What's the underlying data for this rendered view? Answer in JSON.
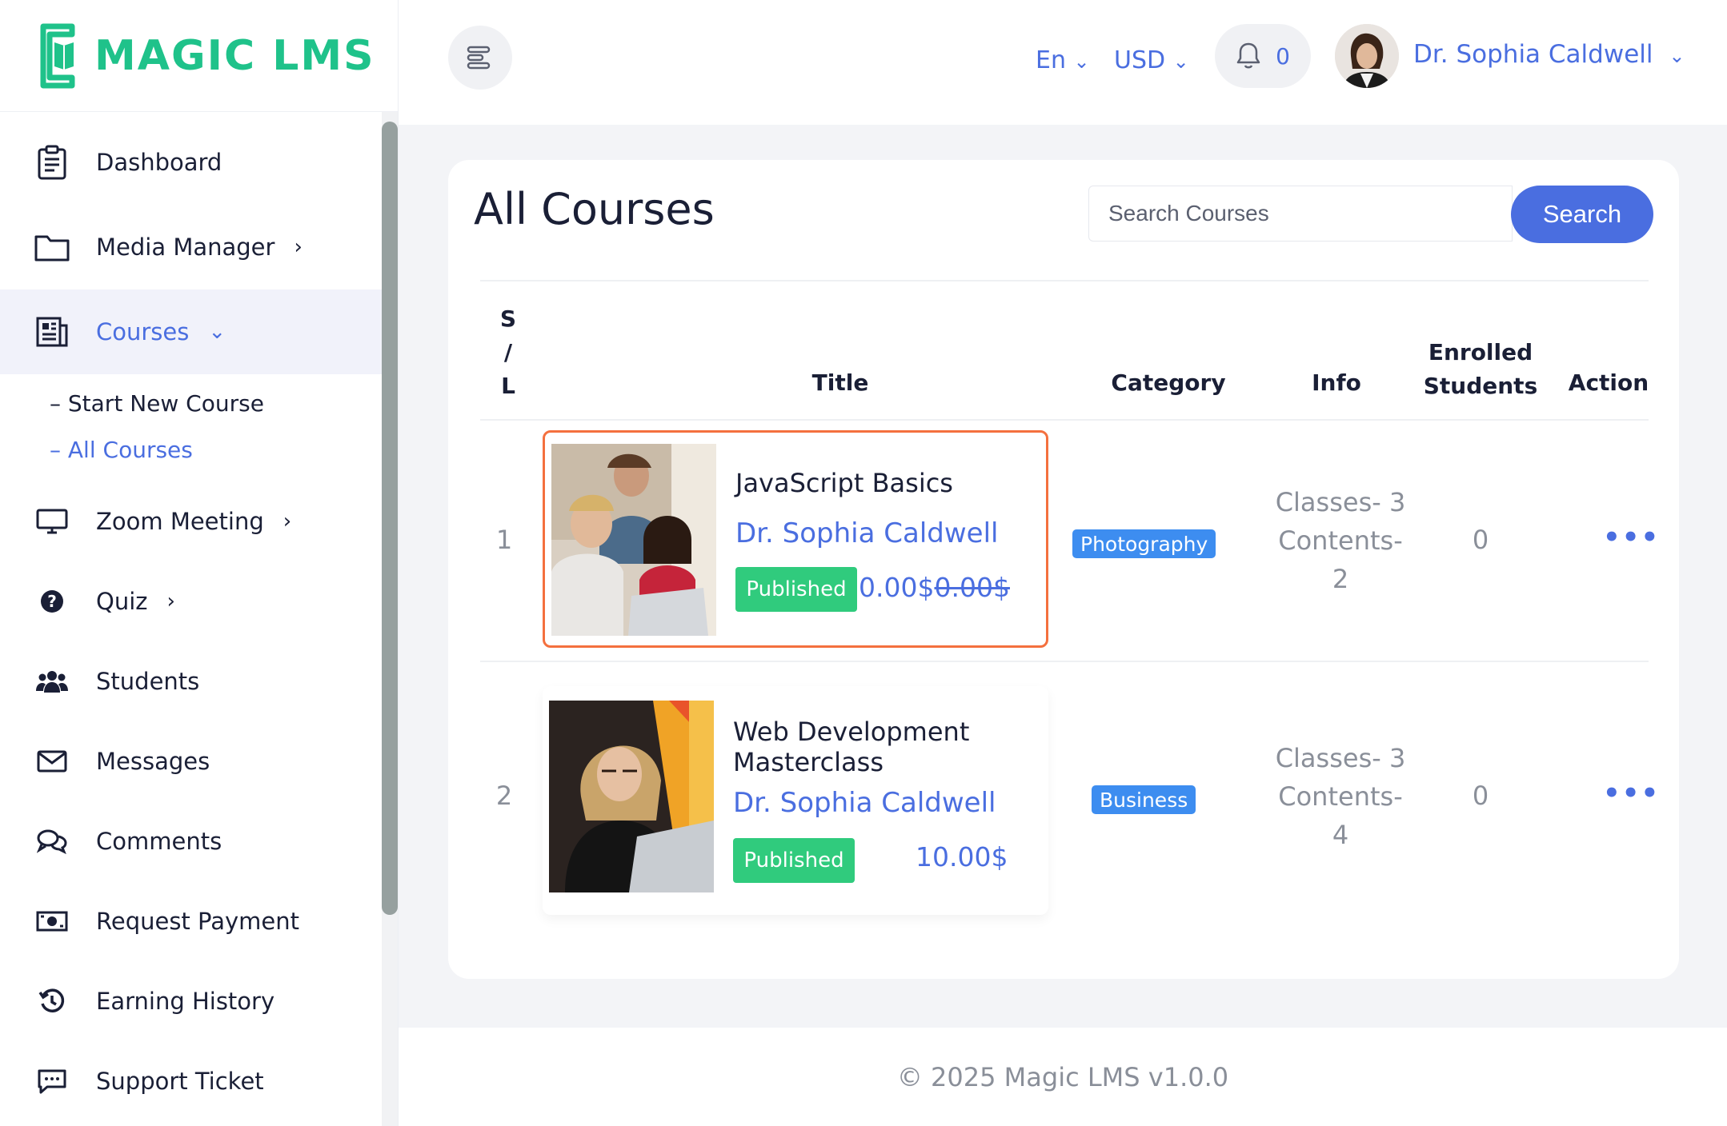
{
  "app": {
    "brand": "MAGIC LMS",
    "brand_color": "#1fc28a",
    "accent": "#4a6ee0"
  },
  "sidebar": {
    "items": [
      {
        "label": "Dashboard",
        "icon": "clipboard-icon"
      },
      {
        "label": "Media Manager",
        "icon": "folder-icon"
      },
      {
        "label": "Courses",
        "icon": "newspaper-icon"
      },
      {
        "label": "Zoom Meeting",
        "icon": "monitor-icon"
      },
      {
        "label": "Quiz",
        "icon": "question-circle-icon"
      },
      {
        "label": "Students",
        "icon": "users-icon"
      },
      {
        "label": "Messages",
        "icon": "envelope-icon"
      },
      {
        "label": "Comments",
        "icon": "comments-icon"
      },
      {
        "label": "Request Payment",
        "icon": "money-bill-icon"
      },
      {
        "label": "Earning History",
        "icon": "history-icon"
      },
      {
        "label": "Support Ticket",
        "icon": "chat-dots-icon"
      }
    ],
    "courses_sub": [
      "– Start New Course",
      "– All Courses"
    ]
  },
  "topbar": {
    "language": "En",
    "currency": "USD",
    "notification_count": "0",
    "user_name": "Dr. Sophia Caldwell"
  },
  "main": {
    "title": "All Courses",
    "search_placeholder": "Search Courses",
    "search_label": "Search",
    "columns": {
      "sl": [
        "S",
        "/",
        "L"
      ],
      "title": "Title",
      "category": "Category",
      "info": "Info",
      "enrolled": [
        "Enrolled",
        "Students"
      ],
      "action": "Action"
    },
    "rows": [
      {
        "sl": "1",
        "title": "JavaScript Basics",
        "author": "Dr. Sophia Caldwell",
        "status": "Published",
        "price": "0.00$",
        "old_price": "0.00$",
        "category": "Photography",
        "info": [
          "Classes- 3",
          "Contents-",
          "2"
        ],
        "enrolled": "0",
        "action": "•••"
      },
      {
        "sl": "2",
        "title": "Web Development Masterclass",
        "author": "Dr. Sophia Caldwell",
        "status": "Published",
        "price": "10.00$",
        "category": "Business",
        "info": [
          "Classes- 3",
          "Contents-",
          "4"
        ],
        "enrolled": "0",
        "action": "•••"
      }
    ]
  },
  "footer": {
    "text": "© 2025 Magic LMS v1.0.0"
  }
}
